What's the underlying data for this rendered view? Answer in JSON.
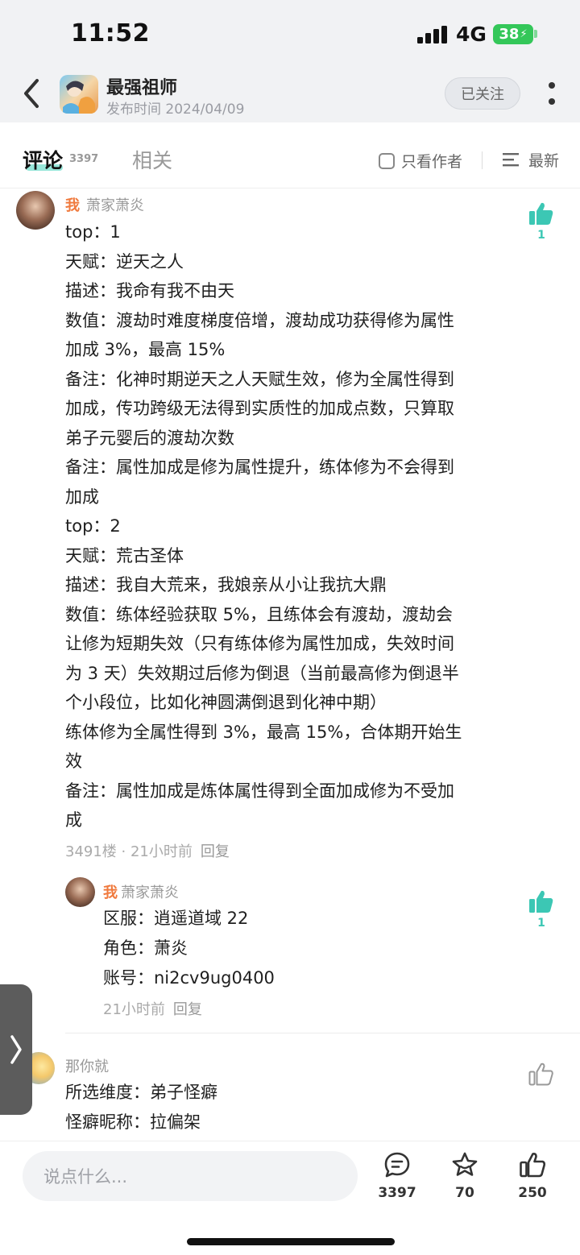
{
  "status_bar": {
    "time": "11:52",
    "network": "4G",
    "battery": "38"
  },
  "header": {
    "title": "最强祖师",
    "date": "发布时间 2024/04/09",
    "follow_label": "已关注"
  },
  "tabs": {
    "comment_label": "评论",
    "comment_count": "3397",
    "related_label": "相关",
    "author_only_label": "只看作者",
    "sort_label": "最新"
  },
  "comment_main": {
    "me_tag": "我",
    "username": "萧家萧炎",
    "likes": "1",
    "lines": [
      "top：1",
      "天赋：逆天之人",
      "描述：我命有我不由天",
      "数值：渡劫时难度梯度倍增，渡劫成功获得修为属性",
      "加成 3%，最高 15%",
      "备注：化神时期逆天之人天赋生效，修为全属性得到",
      "加成，传功跨级无法得到实质性的加成点数，只算取",
      "弟子元婴后的渡劫次数",
      "备注：属性加成是修为属性提升，练体修为不会得到",
      "加成",
      "top：2",
      "天赋：荒古圣体",
      "描述：我自大荒来，我娘亲从小让我抗大鼎",
      "数值：练体经验获取 5%，且练体会有渡劫，渡劫会",
      "让修为短期失效（只有练体修为属性加成，失效时间",
      "为 3 天）失效期过后修为倒退（当前最高修为倒退半",
      "个小段位，比如化神圆满倒退到化神中期）",
      "练体修为全属性得到 3%，最高 15%，合体期开始生",
      "效",
      "备注：属性加成是炼体属性得到全面加成修为不受加",
      "成"
    ],
    "floor": "3491楼 · 21小时前",
    "reply_label": "回复"
  },
  "reply": {
    "me_tag": "我",
    "username": "萧家萧炎",
    "likes": "1",
    "lines": [
      "区服：逍遥道域 22",
      "角色：萧炎",
      "账号：ni2cv9ug0400"
    ],
    "time": "21小时前",
    "reply_label": "回复"
  },
  "comment_third": {
    "username": "那你就",
    "lines": [
      "所选维度：弟子怪癖",
      "怪癖昵称：拉偏架"
    ]
  },
  "bottom_bar": {
    "input_placeholder": "说点什么...",
    "comments_count": "3397",
    "favorites_count": "70",
    "likes_count": "250"
  },
  "colors": {
    "accent_like": "#3cc7b4",
    "me_tag": "#f07a3e",
    "battery": "#34c759"
  },
  "icons": [
    "back-arrow-icon",
    "more-dots-icon",
    "checkbox-icon",
    "sort-icon",
    "thumbs-up-icon",
    "comment-icon",
    "star-icon",
    "chevron-right-icon"
  ]
}
